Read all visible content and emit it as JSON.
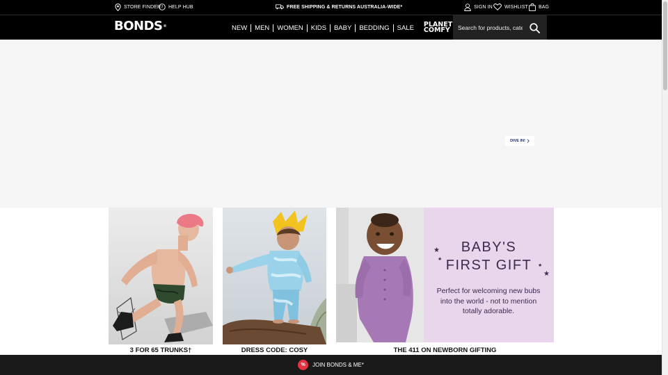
{
  "utility": {
    "store_finder": "STORE FINDER",
    "help_hub": "HELP HUB",
    "shipping": "FREE SHIPPING & RETURNS AUSTRALIA-WIDE*",
    "sign_in": "SIGN IN",
    "wishlist": "WISHLIST",
    "bag": "BAG"
  },
  "header": {
    "logo": "BONDS",
    "logo_mark": "®",
    "nav": [
      "NEW",
      "MEN",
      "WOMEN",
      "KIDS",
      "BABY",
      "BEDDING",
      "SALE"
    ],
    "planet_comfy_1": "PLANET",
    "planet_comfy_2": "COMFY",
    "search_placeholder": "Search for products, categories"
  },
  "hero": {
    "cta": "DIVE IN!"
  },
  "tiles": [
    {
      "caption": "3 FOR 65 TRUNKS†"
    },
    {
      "caption": "DRESS CODE: COSY"
    },
    {
      "caption": "THE 411 ON NEWBORN GIFTING",
      "title_line1": "BABY'S",
      "title_line2": "FIRST GIFT",
      "body": "Perfect for welcoming new bubs into the world - not to mention totally adorable."
    }
  ],
  "footer_bar": {
    "join": "JOIN BONDS & ME*",
    "badge": "%"
  },
  "colors": {
    "bar": "#000000",
    "gift_panel": "#e9d5ec",
    "gift_text": "#3b2b4e",
    "join_badge": "#e8313f"
  }
}
